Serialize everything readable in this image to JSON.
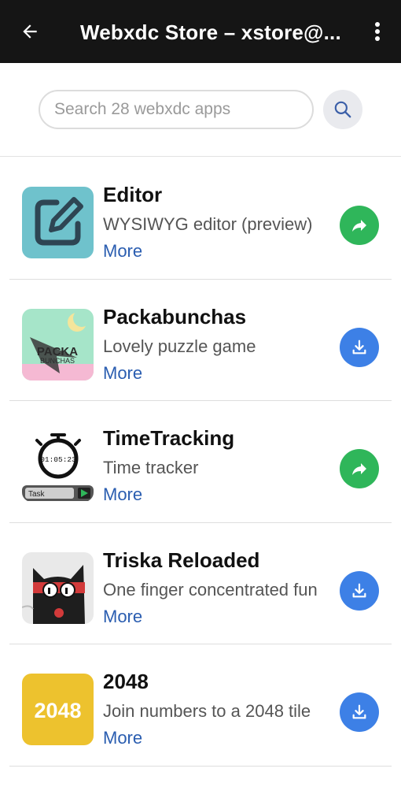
{
  "appbar": {
    "title": "Webxdc Store – xstore@...",
    "back_icon": "arrow-back-icon",
    "menu_icon": "more-vert-icon"
  },
  "search": {
    "placeholder": "Search 28 webxdc apps",
    "button_icon": "search-icon"
  },
  "colors": {
    "appbar_bg": "#151515",
    "open_action": "#2fb65a",
    "download_action": "#3d80e6",
    "more_link": "#2a5db0"
  },
  "apps": [
    {
      "name": "Editor",
      "description": "WYSIWYG editor (preview)",
      "more": "More",
      "action": "open",
      "action_icon": "share-arrow-icon"
    },
    {
      "name": "Packabunchas",
      "description": "Lovely puzzle game",
      "more": "More",
      "action": "download",
      "action_icon": "download-icon",
      "icon_text": [
        "PACKA",
        "BUNCHAS"
      ]
    },
    {
      "name": "TimeTracking",
      "description": "Time tracker",
      "more": "More",
      "action": "open",
      "action_icon": "share-arrow-icon",
      "icon_text": [
        "01:05:23",
        "Task"
      ]
    },
    {
      "name": "Triska Reloaded",
      "description": "One finger concentrated fun",
      "more": "More",
      "action": "download",
      "action_icon": "download-icon"
    },
    {
      "name": "2048",
      "description": "Join numbers to a 2048 tile",
      "more": "More",
      "action": "download",
      "action_icon": "download-icon",
      "icon_text": [
        "2048"
      ]
    }
  ]
}
